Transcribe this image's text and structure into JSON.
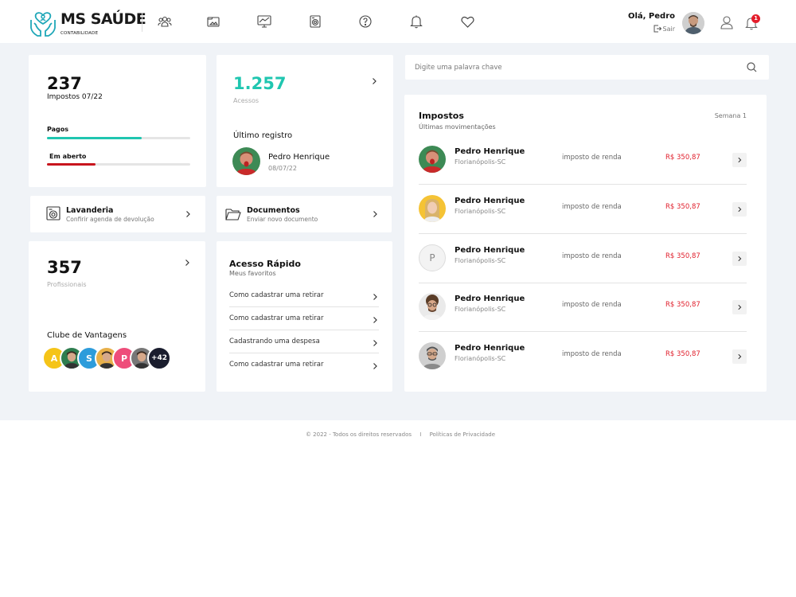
{
  "brand": {
    "title": "MS SAÚDE",
    "subtitle": "CONTABILIDADE"
  },
  "nav": [
    "people-icon",
    "folder-image-icon",
    "monitor-chart-icon",
    "washing-machine-icon",
    "help-icon",
    "bell-icon",
    "heart-icon"
  ],
  "user": {
    "greeting": "Olá, Pedro",
    "logout": "Sair",
    "notifications": "1"
  },
  "impostos_card": {
    "count": "237",
    "label": "Impostos 07/22",
    "paid_label": "Pagos",
    "paid_fraction": 0.66,
    "open_label": "Em aberto",
    "open_fraction": 0.34,
    "colors": {
      "paid": "#1fc6b0",
      "open": "#c8151d"
    }
  },
  "acessos_card": {
    "count": "1.257",
    "label": "Acessos",
    "last_title": "Último registro",
    "last_name": "Pedro Henrique",
    "last_date": "08/07/22",
    "accent": "#1fc6b0"
  },
  "lavanderia": {
    "title": "Lavanderia",
    "subtitle": "Confirir agenda de devolução"
  },
  "documentos": {
    "title": "Documentos",
    "subtitle": "Enviar novo documento"
  },
  "profissionais": {
    "count": "357",
    "label": "Profissionais",
    "club_title": "Clube de Vantagens",
    "members": [
      {
        "label": "A",
        "color": "#f5c418"
      },
      {
        "label": "",
        "color": "#2e7d4f"
      },
      {
        "label": "S",
        "color": "#2d9cdb"
      },
      {
        "label": "",
        "color": "#e8b04a"
      },
      {
        "label": "P",
        "color": "#ee4d7a"
      },
      {
        "label": "",
        "color": "#777777"
      },
      {
        "label": "+42",
        "color": "#1a1d2e"
      }
    ]
  },
  "quick_access": {
    "title": "Acesso Rápido",
    "subtitle": "Meus favoritos",
    "items": [
      "Como cadastrar uma retirar",
      "Como cadastrar uma retirar",
      "Cadastrando uma despesa",
      "Como cadastrar uma retirar"
    ]
  },
  "search": {
    "placeholder": "Digite uma palavra chave"
  },
  "taxes": {
    "title": "Impostos",
    "subtitle": "Últimas movimentações",
    "week": "Semana 1",
    "rows": [
      {
        "name": "Pedro Henrique",
        "city": "Florianópolis-SC",
        "type": "imposto de renda",
        "value": "R$ 350,87",
        "avatar": "green"
      },
      {
        "name": "Pedro Henrique",
        "city": "Florianópolis-SC",
        "type": "imposto de renda",
        "value": "R$ 350,87",
        "avatar": "yellow"
      },
      {
        "name": "Pedro Henrique",
        "city": "Florianópolis-SC",
        "type": "imposto de renda",
        "value": "R$ 350,87",
        "avatar": "P"
      },
      {
        "name": "Pedro Henrique",
        "city": "Florianópolis-SC",
        "type": "imposto de renda",
        "value": "R$ 350,87",
        "avatar": "curly"
      },
      {
        "name": "Pedro Henrique",
        "city": "Florianópolis-SC",
        "type": "imposto de renda",
        "value": "R$ 350,87",
        "avatar": "glasses"
      }
    ]
  },
  "footer": {
    "copyright": "© 2022 - Todos os direitos reservados",
    "separator": "I",
    "privacy": "Políticas de Privacidade"
  }
}
